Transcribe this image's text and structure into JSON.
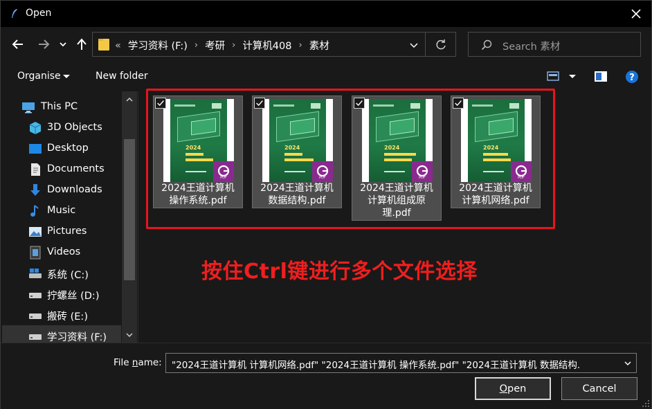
{
  "window": {
    "title": "Open",
    "icon": "feather-icon"
  },
  "address": {
    "prefix": "«",
    "crumbs": [
      "学习资料 (F:)",
      "考研",
      "计算机408",
      "素材"
    ],
    "separator": "›"
  },
  "search": {
    "placeholder": "Search 素材"
  },
  "toolbar": {
    "organise_label": "Organise",
    "new_folder_label": "New folder"
  },
  "sidebar": {
    "items": [
      {
        "label": "This PC",
        "icon": "computer-icon"
      },
      {
        "label": "3D Objects",
        "icon": "cube-icon"
      },
      {
        "label": "Desktop",
        "icon": "desktop-icon"
      },
      {
        "label": "Documents",
        "icon": "document-icon"
      },
      {
        "label": "Downloads",
        "icon": "download-icon"
      },
      {
        "label": "Music",
        "icon": "music-icon"
      },
      {
        "label": "Pictures",
        "icon": "pictures-icon"
      },
      {
        "label": "Videos",
        "icon": "video-icon"
      },
      {
        "label": "系统 (C:)",
        "icon": "drive-icon"
      },
      {
        "label": "拧螺丝 (D:)",
        "icon": "drive-icon"
      },
      {
        "label": "搬砖 (E:)",
        "icon": "drive-icon"
      },
      {
        "label": "学习资料 (F:)",
        "icon": "drive-icon"
      }
    ]
  },
  "files": [
    {
      "name_line1": "2024王道计算机",
      "name_line2": "操作系统.pdf",
      "name_line3": "",
      "cover_year": "2024",
      "checked": true
    },
    {
      "name_line1": "2024王道计算机",
      "name_line2": "数据结构.pdf",
      "name_line3": "",
      "cover_year": "2024",
      "checked": true
    },
    {
      "name_line1": "2024王道计算机",
      "name_line2": "计算机组成原",
      "name_line3": "理.pdf",
      "cover_year": "2024",
      "checked": true
    },
    {
      "name_line1": "2024王道计算机",
      "name_line2": "计算机网络.pdf",
      "name_line3": "",
      "cover_year": "2024",
      "checked": true
    }
  ],
  "annotation": "按住Ctrl键进行多个文件选择",
  "bottom": {
    "file_name_label_pre": "File ",
    "file_name_label_u": "n",
    "file_name_label_post": "ame:",
    "file_name_value": "\"2024王道计算机 计算机网络.pdf\" \"2024王道计算机 操作系统.pdf\" \"2024王道计算机 数据结构.",
    "open_u": "O",
    "open_rest": "pen",
    "cancel_label": "Cancel"
  },
  "colors": {
    "highlight_red": "#e8141d",
    "background": "#191919",
    "help_blue": "#1a73d9"
  }
}
